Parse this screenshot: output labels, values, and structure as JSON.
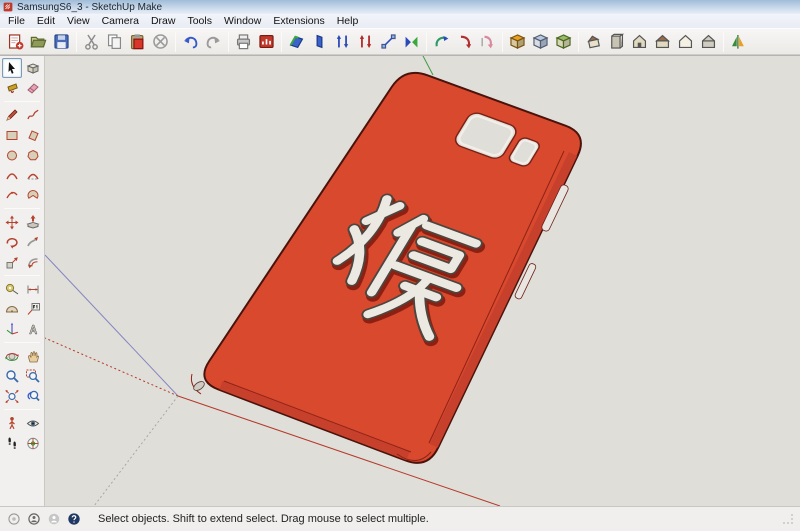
{
  "window": {
    "title": "SamsungS6_3 - SketchUp Make",
    "app_icon": "sketchup-logo-icon"
  },
  "menu_bar": {
    "items": [
      "File",
      "Edit",
      "View",
      "Camera",
      "Draw",
      "Tools",
      "Window",
      "Extensions",
      "Help"
    ]
  },
  "top_toolbar": {
    "groups": [
      [
        "new-icon",
        "open-icon",
        "save-icon"
      ],
      [
        "cut-icon",
        "copy-icon",
        "paste-icon",
        "erase-icon"
      ],
      [
        "undo-icon",
        "redo-icon"
      ],
      [
        "print-icon",
        "model-info-icon"
      ],
      [
        "plane-tool-icon",
        "slab-tool-icon",
        "arrows-vertical-blue-icon",
        "arrows-vertical-red-icon",
        "diagonal-move-icon",
        "bowtie-tool-icon"
      ],
      [
        "curved-arrow-green-icon",
        "curved-arrow-red-icon",
        "curved-arrow-pink-icon"
      ],
      [
        "cube-orange-icon",
        "cube-blue-icon",
        "cube-green-icon"
      ],
      [
        "view-iso-icon",
        "view-box-icon",
        "view-front-icon",
        "view-top-icon",
        "view-side-icon",
        "view-back-icon"
      ],
      [
        "mirror-icon"
      ]
    ]
  },
  "tool_palette": {
    "active_tool": "select-icon",
    "groups": [
      [
        [
          "select-icon",
          "make-component-icon"
        ],
        [
          "paint-bucket-icon",
          "eraser-icon"
        ]
      ],
      [
        [
          "line-icon",
          "freehand-icon"
        ],
        [
          "rectangle-icon",
          "rotated-rectangle-icon"
        ],
        [
          "circle-icon",
          "polygon-icon"
        ],
        [
          "arc-icon",
          "two-point-arc-icon"
        ],
        [
          "three-point-arc-icon",
          "pie-icon"
        ]
      ],
      [
        [
          "move-icon",
          "push-pull-icon"
        ],
        [
          "rotate-icon",
          "follow-me-icon"
        ],
        [
          "scale-icon",
          "offset-icon"
        ]
      ],
      [
        [
          "tape-measure-icon",
          "dimension-icon"
        ],
        [
          "protractor-icon",
          "text-icon"
        ],
        [
          "axes-icon",
          "3d-text-icon"
        ]
      ],
      [
        [
          "orbit-icon",
          "pan-icon"
        ],
        [
          "zoom-icon",
          "zoom-window-icon"
        ],
        [
          "zoom-extents-icon",
          "zoom-previous-icon"
        ]
      ],
      [
        [
          "position-camera-icon",
          "look-around-icon"
        ],
        [
          "walk-icon",
          "section-plane-icon"
        ]
      ]
    ]
  },
  "viewport": {
    "model": {
      "name": "Samsung S6 phone case",
      "engraved_character": "猴",
      "colors": {
        "face": "#d8492e",
        "rim": "#c7402c",
        "rim_line": "#8e2317",
        "outline": "#4a130b",
        "character_fill": "#ece9e3",
        "character_edge": "#4e463e",
        "character_shadow": "#8c2012",
        "cutout_edge": "#7a2014"
      }
    },
    "background": "#e0ded8",
    "axes_colors": {
      "red": "#b5392b",
      "blue": "#8585c2",
      "green": "#3f9b44",
      "green_dotted": "#a3ab9e"
    }
  },
  "status_bar": {
    "icons": [
      "geolocation-icon",
      "claim-credit-icon",
      "sign-in-icon",
      "help-icon"
    ],
    "message": "Select objects. Shift to extend select. Drag mouse to select multiple."
  }
}
